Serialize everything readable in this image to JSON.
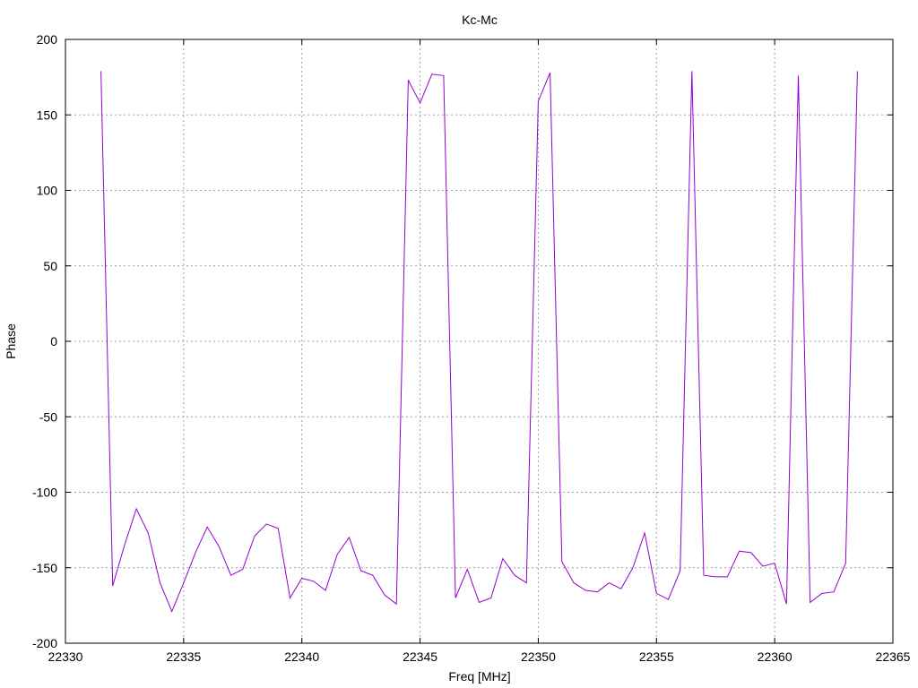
{
  "chart_data": {
    "type": "line",
    "title": "Kc-Mc",
    "xlabel": "Freq [MHz]",
    "ylabel": "Phase",
    "xlim": [
      22330,
      22365
    ],
    "ylim": [
      -200,
      200
    ],
    "x_ticks": [
      22330,
      22335,
      22340,
      22345,
      22350,
      22355,
      22360,
      22365
    ],
    "y_ticks": [
      -200,
      -150,
      -100,
      -50,
      0,
      50,
      100,
      150,
      200
    ],
    "grid": true,
    "line_color": "#9400d3",
    "series": [
      {
        "x": [
          22331.5,
          22332.0,
          22332.5,
          22333.0,
          22333.5,
          22334.0,
          22334.5,
          22335.0,
          22335.5,
          22336.0,
          22336.5,
          22337.0,
          22337.5,
          22338.0,
          22338.5,
          22339.0,
          22339.5,
          22340.0,
          22340.5,
          22341.0,
          22341.5,
          22342.0,
          22342.5,
          22343.0,
          22343.5,
          22344.0,
          22344.5,
          22345.0,
          22345.5,
          22346.0,
          22346.5,
          22347.0,
          22347.5,
          22348.0,
          22348.5,
          22349.0,
          22349.5,
          22350.0,
          22350.5,
          22351.0,
          22351.5,
          22352.0,
          22352.5,
          22353.0,
          22353.5,
          22354.0,
          22354.5,
          22355.0,
          22355.5,
          22356.0,
          22356.5,
          22357.0,
          22357.5,
          22358.0,
          22358.5,
          22359.0,
          22359.5,
          22360.0,
          22360.5,
          22361.0,
          22361.5,
          22362.0,
          22362.5,
          22363.0,
          22363.5
        ],
        "y": [
          179,
          -162,
          -135,
          -111,
          -127,
          -160,
          -179,
          -160,
          -140,
          -123,
          -136,
          -155,
          -151,
          -129,
          -121,
          -124,
          -170,
          -157,
          -159,
          -165,
          -141,
          -130,
          -152,
          -155,
          -168,
          -174,
          173,
          158,
          177,
          176,
          -170,
          -151,
          -173,
          -170,
          -144,
          -155,
          -160,
          159,
          178,
          -146,
          -160,
          -165,
          -166,
          -160,
          -164,
          -150,
          -127,
          -167,
          -171,
          -152,
          179,
          -155,
          -156,
          -156,
          -139,
          -140,
          -149,
          -147,
          -174,
          176,
          -173,
          -167,
          -166,
          -147,
          179
        ]
      }
    ]
  }
}
